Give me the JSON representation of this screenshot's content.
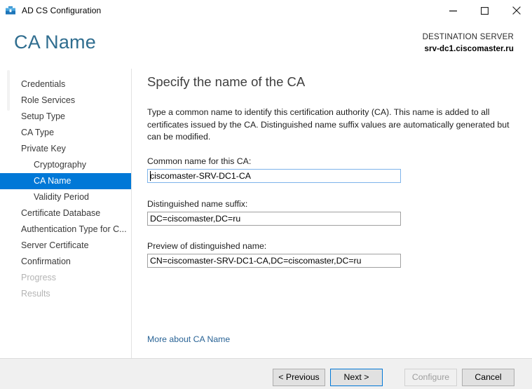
{
  "window": {
    "title": "AD CS Configuration",
    "icon": "toolbox-icon",
    "controls": {
      "minimize": "minimize-icon",
      "maximize": "maximize-icon",
      "close": "close-icon"
    }
  },
  "header": {
    "page_title": "CA Name",
    "destination_label": "DESTINATION SERVER",
    "destination_server": "srv-dc1.ciscomaster.ru"
  },
  "nav": {
    "items": [
      {
        "label": "Credentials",
        "level": 0,
        "state": "normal"
      },
      {
        "label": "Role Services",
        "level": 0,
        "state": "normal"
      },
      {
        "label": "Setup Type",
        "level": 0,
        "state": "normal"
      },
      {
        "label": "CA Type",
        "level": 0,
        "state": "normal"
      },
      {
        "label": "Private Key",
        "level": 0,
        "state": "normal"
      },
      {
        "label": "Cryptography",
        "level": 1,
        "state": "normal"
      },
      {
        "label": "CA Name",
        "level": 1,
        "state": "selected"
      },
      {
        "label": "Validity Period",
        "level": 1,
        "state": "normal"
      },
      {
        "label": "Certificate Database",
        "level": 0,
        "state": "normal"
      },
      {
        "label": "Authentication Type for C...",
        "level": 0,
        "state": "normal"
      },
      {
        "label": "Server Certificate",
        "level": 0,
        "state": "normal"
      },
      {
        "label": "Confirmation",
        "level": 0,
        "state": "normal"
      },
      {
        "label": "Progress",
        "level": 0,
        "state": "disabled"
      },
      {
        "label": "Results",
        "level": 0,
        "state": "disabled"
      }
    ]
  },
  "content": {
    "title": "Specify the name of the CA",
    "description": "Type a common name to identify this certification authority (CA). This name is added to all certificates issued by the CA. Distinguished name suffix values are automatically generated but can be modified.",
    "fields": [
      {
        "label": "Common name for this CA:",
        "value": "ciscomaster-SRV-DC1-CA",
        "placeholder": "",
        "focused": true
      },
      {
        "label": "Distinguished name suffix:",
        "value": "DC=ciscomaster,DC=ru",
        "placeholder": "",
        "focused": false
      },
      {
        "label": "Preview of distinguished name:",
        "value": "CN=ciscomaster-SRV-DC1-CA,DC=ciscomaster,DC=ru",
        "placeholder": "",
        "focused": false
      }
    ],
    "more_link": "More about CA Name"
  },
  "footer": {
    "previous": "< Previous",
    "next": "Next >",
    "configure": "Configure",
    "cancel": "Cancel"
  },
  "colors": {
    "accent": "#0078d7",
    "title_blue": "#2f6d8f",
    "link_blue": "#2a6496",
    "footer_bg": "#f0f0f0"
  }
}
